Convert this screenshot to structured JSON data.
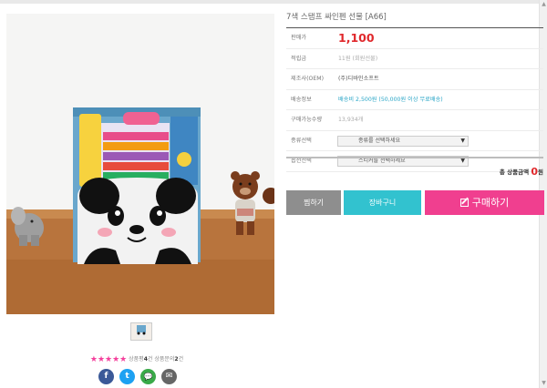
{
  "product": {
    "title": "7색 스탬프 싸인펜 선물 [A66]"
  },
  "info": {
    "rows": [
      {
        "label": "판매가",
        "value": "1,100"
      },
      {
        "label": "적립금",
        "value": "11원 (회원선물)"
      },
      {
        "label": "제조사(OEM)",
        "value": "(주)디바인소프트"
      },
      {
        "label": "배송정보",
        "value": "배송비 2,500원 (50,000원 이상 무료배송)"
      },
      {
        "label": "구매가능수량",
        "value": "13,934개"
      },
      {
        "label": "종류선택",
        "value": "종류를 선택하세요"
      },
      {
        "label": "옵션선택",
        "value": "스티커를 선택하세요"
      }
    ]
  },
  "total": {
    "label": "총 상품금액",
    "amount": "0",
    "unit": "원"
  },
  "buttons": {
    "wish": "찜하기",
    "cart": "장바구니",
    "buy": "구매하기"
  },
  "rating": {
    "stars": "★★★★★",
    "text_prefix": "상품평",
    "review_count": "4",
    "text_mid": "건 상품문의",
    "inquiry_count": "2",
    "text_suffix": "건",
    "score": 5,
    "max": 5
  },
  "share": [
    {
      "name": "facebook",
      "glyph": "f",
      "color": "#3b5998"
    },
    {
      "name": "twitter",
      "glyph": "t",
      "color": "#1da1f2"
    },
    {
      "name": "kakaotalk",
      "glyph": "💬",
      "color": "#3aa948"
    },
    {
      "name": "email",
      "glyph": "✉",
      "color": "#666666"
    }
  ],
  "colors": {
    "price": "#e0282c",
    "wish_button": "#8e8e8e",
    "cart_button": "#32c2cf",
    "buy_button": "#f03f8f",
    "stars": "#f4409c"
  }
}
